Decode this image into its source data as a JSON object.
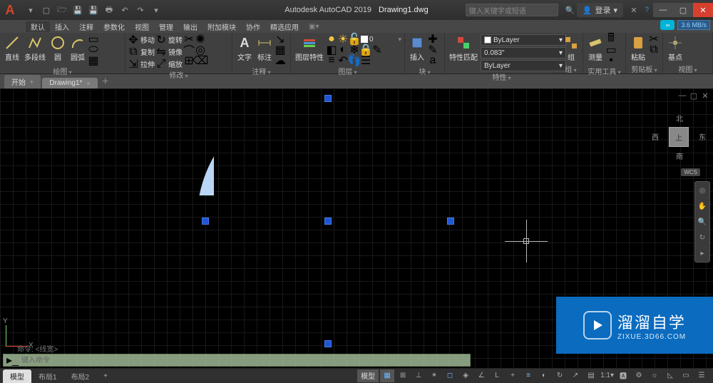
{
  "title": {
    "app": "Autodesk AutoCAD 2019",
    "file": "Drawing1.dwg"
  },
  "search": {
    "placeholder": "键入关键字或短语"
  },
  "login": "登录",
  "speed": "3.6 MB/s",
  "menus": [
    "默认",
    "插入",
    "注释",
    "参数化",
    "视图",
    "管理",
    "输出",
    "附加模块",
    "协作",
    "精选应用"
  ],
  "ribbon": {
    "draw": {
      "label": "绘图",
      "line": "直线",
      "pline": "多段线",
      "circle": "圆",
      "arc": "圆弧"
    },
    "modify": {
      "label": "修改",
      "move": "移动",
      "rotate": "旋转",
      "copy": "复制",
      "mirror": "镜像",
      "stretch": "拉伸",
      "scale": "缩放"
    },
    "annot": {
      "label": "注释",
      "text": "文字",
      "dim": "标注"
    },
    "layer": {
      "label": "图层",
      "mgr": "图层特性"
    },
    "block": {
      "label": "块",
      "insert": "插入"
    },
    "prop": {
      "label": "特性",
      "match": "特性匹配",
      "layer": "ByLayer",
      "lw": "0.083\"",
      "lt": "ByLayer"
    },
    "group": {
      "label": "组",
      "g": "组"
    },
    "util": {
      "label": "实用工具",
      "meas": "测量"
    },
    "clip": {
      "label": "剪贴板",
      "paste": "粘贴"
    },
    "view": {
      "label": "视图",
      "base": "基点"
    }
  },
  "tabs": {
    "start": "开始",
    "drawing": "Drawing1*"
  },
  "viewcube": {
    "top": "上",
    "n": "北",
    "s": "南",
    "e": "东",
    "w": "西",
    "wcs": "WCS"
  },
  "ucs": {
    "y": "Y",
    "x": "X"
  },
  "cmd": {
    "history": "命令: <线宽>",
    "prompt": "键入命令"
  },
  "layouts": {
    "model": "模型",
    "l1": "布局1",
    "l2": "布局2"
  },
  "status": {
    "model": "模型"
  },
  "watermark": {
    "main": "溜溜自学",
    "sub": "ZIXUE.3D66.COM"
  }
}
